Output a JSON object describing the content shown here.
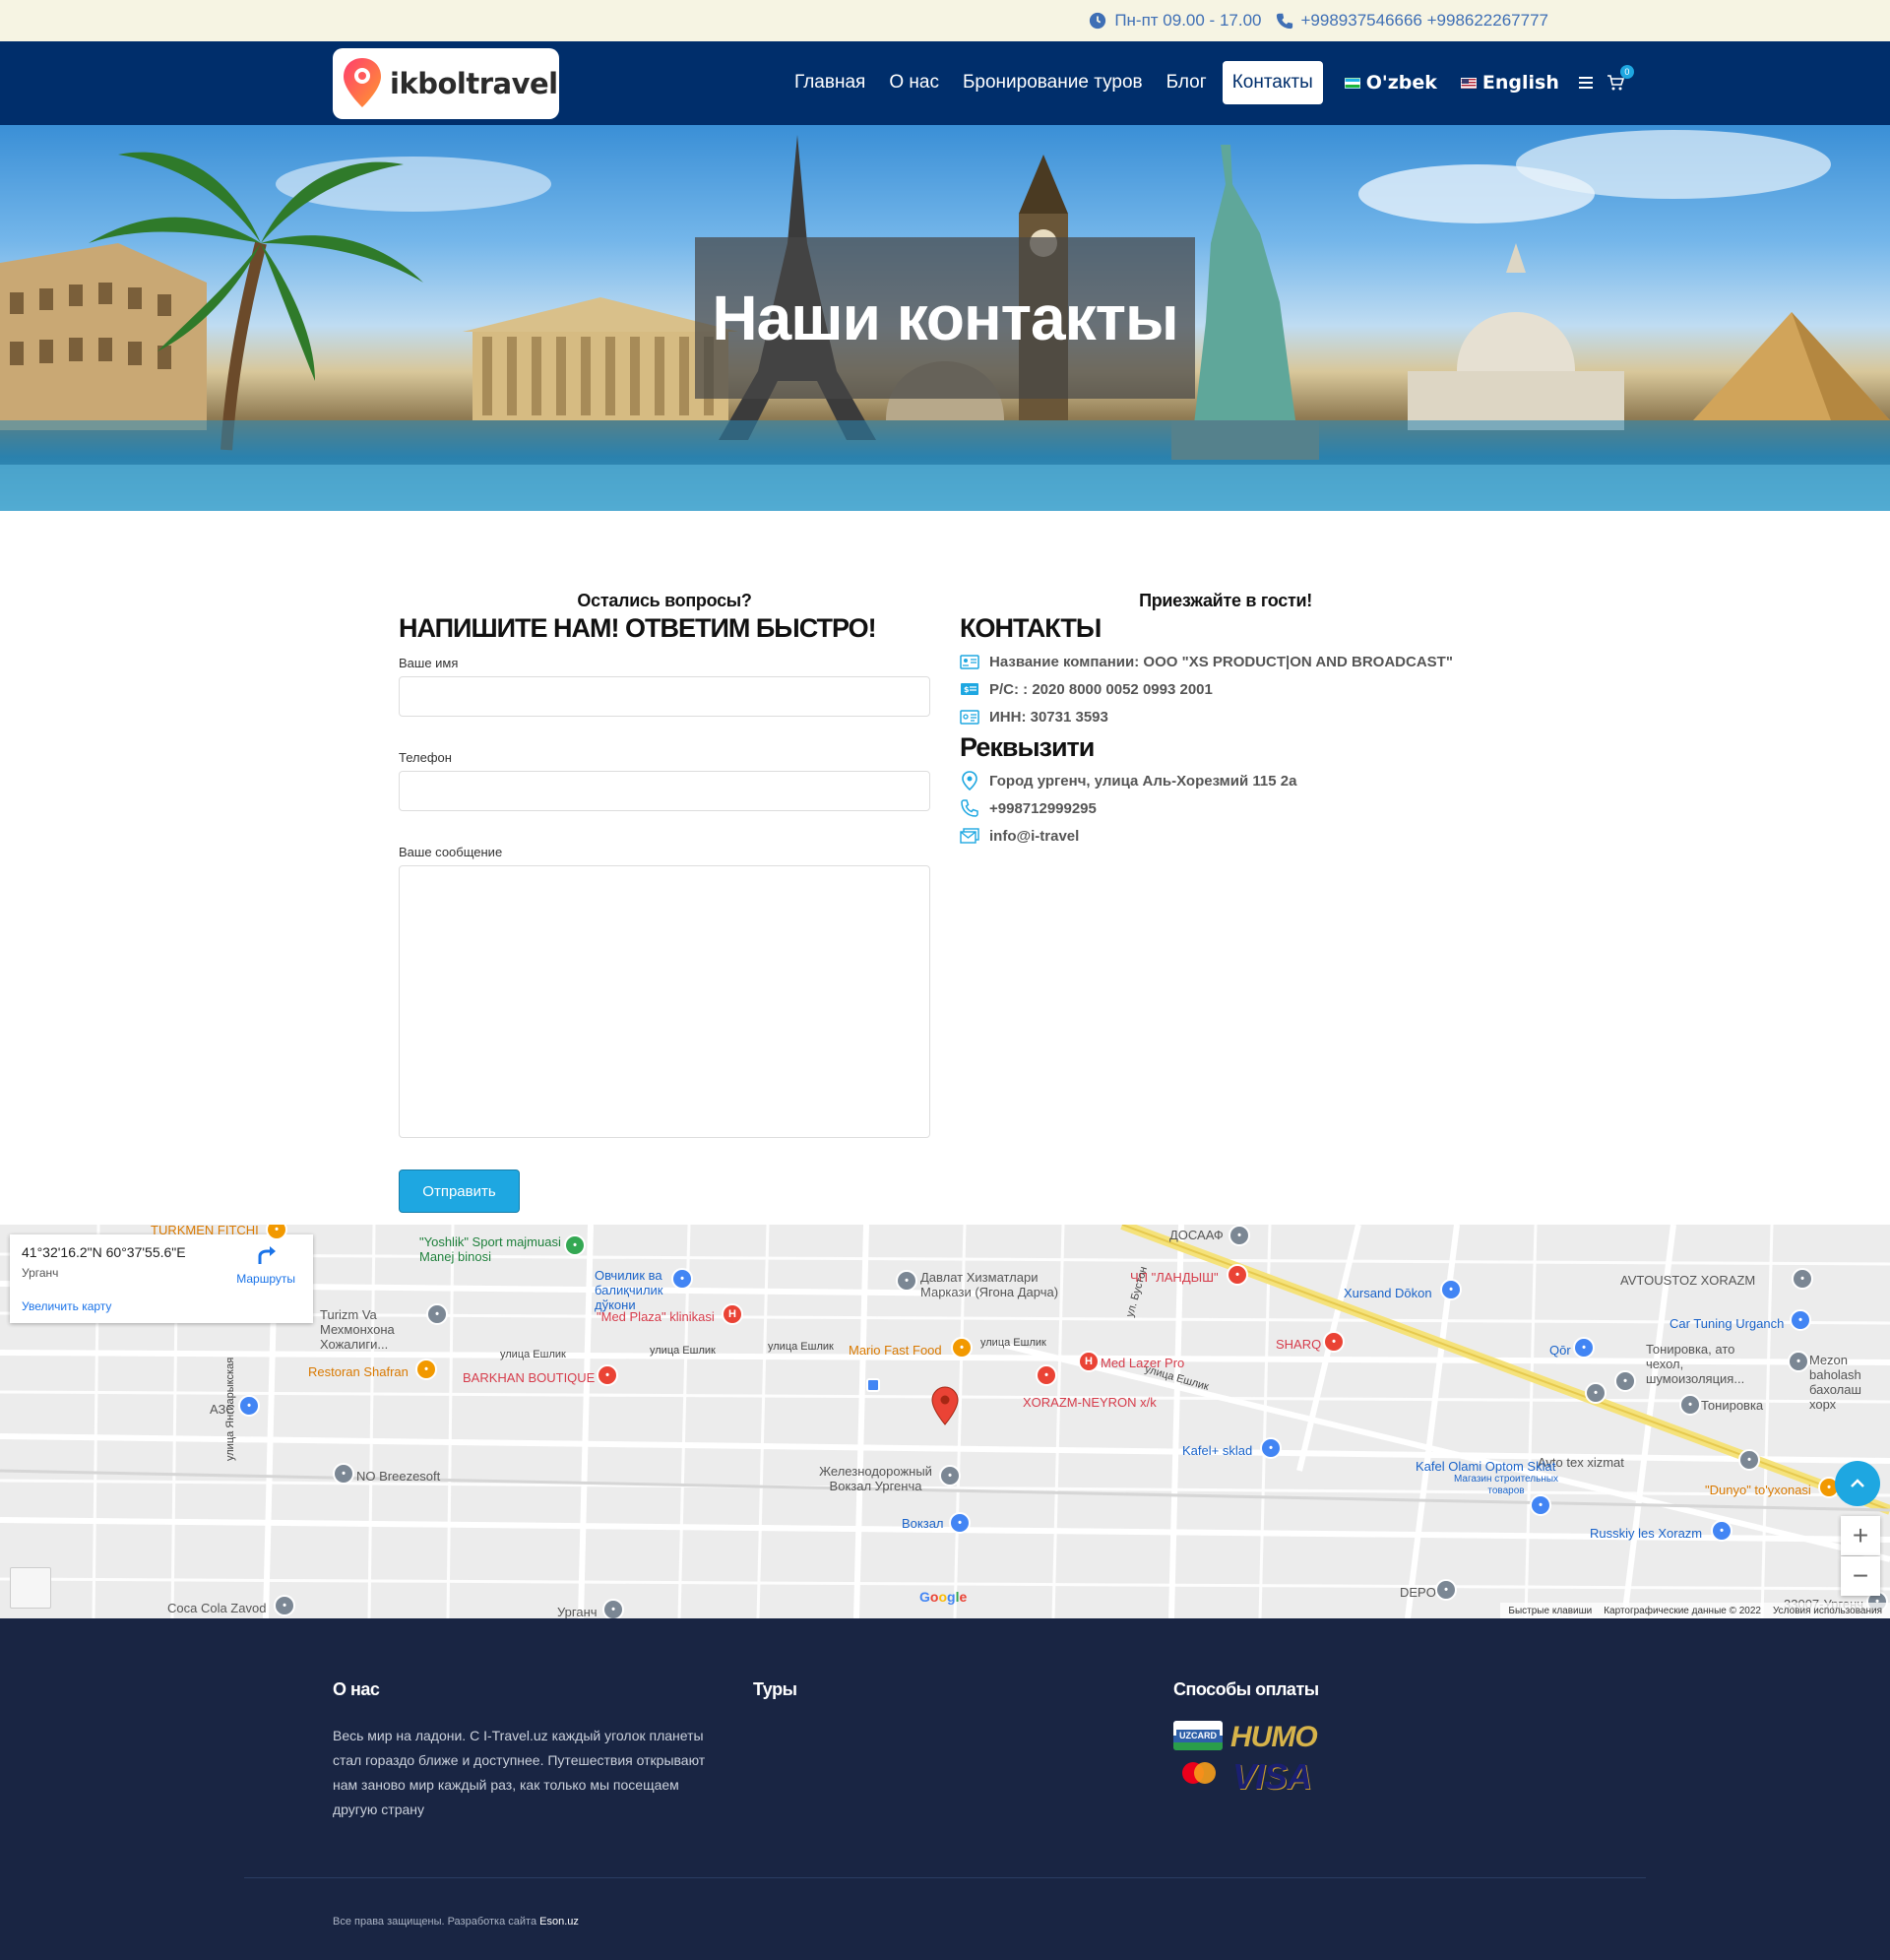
{
  "topbar": {
    "hours": "Пн-пт 09.00 - 17.00",
    "phones": "+998937546666 +998622267777"
  },
  "logo": {
    "text": "ikboltravel"
  },
  "nav": {
    "items": [
      "Главная",
      "О нас",
      "Бронирование туров",
      "Блог",
      "Контакты"
    ],
    "active_index": 4,
    "lang_uz": "O'zbek",
    "lang_en": "English",
    "cart_count": "0"
  },
  "hero": {
    "title": "Наши контакты"
  },
  "form": {
    "subtitle": "Остались вопросы?",
    "title": "НАПИШИТЕ НАМ! ОТВЕТИМ БЫСТРО!",
    "name_label": "Ваше имя",
    "phone_label": "Телефон",
    "message_label": "Ваше сообщение",
    "submit_label": "Отправить"
  },
  "contacts": {
    "subtitle": "Приезжайте в гости!",
    "title": "КОНТАКТЫ",
    "company": "Название компании: ООО \"XS PRODUCT|ON AND BROADCAST\"",
    "account": "Р/С: : 2020 8000 0052 0993 2001",
    "inn": "ИНН: 30731 3593",
    "details_title": "Реквызити",
    "address": "Город ургенч, улица Аль-Хорезмий 115 2а",
    "phone": "+998712999295",
    "email": "info@i-travel"
  },
  "map": {
    "coords": "41°32'16.2\"N 60°37'55.6\"E",
    "city": "Урганч",
    "enlarge": "Увеличить карту",
    "routes": "Маршруты",
    "shortcuts": "Быстрые клавиши",
    "map_data": "Картографические данные © 2022",
    "terms": "Условия использования",
    "google": "Google",
    "pois": [
      "TURKMEN FITCHI",
      "\"Yoshlik\" Sport majmuasi Manej binosi",
      "ДОСААФ",
      "Овчилик ва балиқчилик дўкони",
      "Давлат Хизматлари Маркази (Ягона Дарча)",
      "ЧП \"ЛАНДЫШ\"",
      "Xursand Dōkon",
      "AVTOUSTOZ XORAZM",
      "Turizm Va Мехмонхона Хожалиги...",
      "\"Med Plaza\" klinikasi",
      "Car Tuning Urganch",
      "SHARQ",
      "Qōr",
      "Тонировка, ато чехол, шумоизоляция...",
      "Mezon baholash бахолаш хорх",
      "Mario Fast Food",
      "Med Lazer Pro",
      "Restoran Shafran",
      "BARKHAN BOUTIQUE",
      "XORAZM-NEYRON x/k",
      "Тонировка",
      "АЗС",
      "Kafel+ sklad",
      "Avto tex xizmat",
      "NO Breezesoft",
      "Железнодорожный Вокзал Ургенча",
      "Kafel Olami Optom Sklat",
      "Магазин строительных товаров",
      "\"Dunyo\" to'yxonasi",
      "Вокзал",
      "Russkiy les Xorazm",
      "Coca Cola Zavod",
      "Урганч",
      "DEPO",
      "33007-Ургенч В..."
    ],
    "streets": [
      "улица Ешлик",
      "улица Ешлик",
      "улица Ешлик",
      "улица Ешлик",
      "улица Ешлик",
      "улица Янгиарыкская",
      "ул. Бустон"
    ]
  },
  "footer": {
    "about_title": "О нас",
    "about_text": "Весь мир на ладони. С I-Travel.uz каждый уголок планеты стал гораздо ближе и доступнее. Путешествия открывают нам заново мир каждый раз, как только мы посещаем другую страну",
    "tours_title": "Туры",
    "payments_title": "Способы оплаты",
    "payments": [
      "UZCARD",
      "HUMO",
      "VISA"
    ],
    "copyright": "Все права защищены. Разработка сайта ",
    "copyright_brand": "Eson.uz"
  }
}
